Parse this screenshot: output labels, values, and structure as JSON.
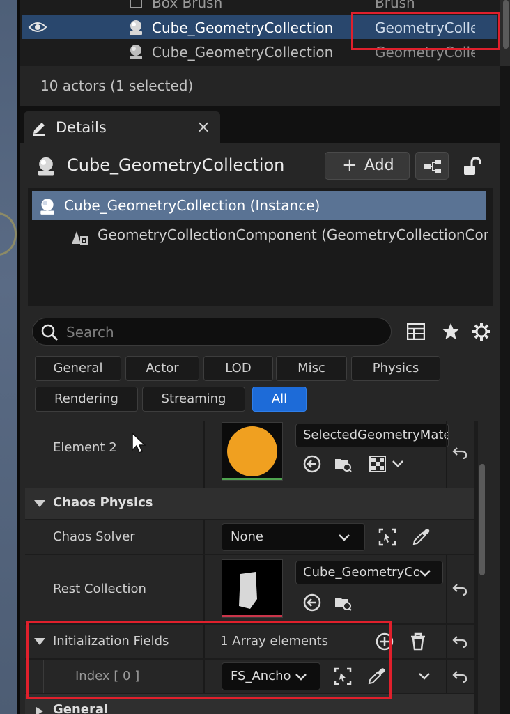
{
  "outliner": {
    "rows": [
      {
        "name": "Box Brush",
        "type": "Brush"
      },
      {
        "name": "Cube_GeometryCollection",
        "type": "GeometryCollectionActor",
        "selected": true
      },
      {
        "name": "Cube_GeometryCollection",
        "type": "GeometryCollectionActor"
      }
    ],
    "actor_count": "10 actors (1 selected)"
  },
  "details_tab": {
    "label": "Details",
    "close": "×"
  },
  "header": {
    "actor_name": "Cube_GeometryCollection",
    "add_label": "Add",
    "add_plus": "+"
  },
  "components": {
    "root": "Cube_GeometryCollection (Instance)",
    "child": "GeometryCollectionComponent (GeometryCollectionComponent)"
  },
  "search": {
    "placeholder": "Search"
  },
  "filters": [
    "General",
    "Actor",
    "LOD",
    "Misc",
    "Physics",
    "Rendering",
    "Streaming",
    "All"
  ],
  "active_filter": "All",
  "properties": {
    "element2": {
      "label": "Element 2",
      "material": "SelectedGeometryMaterial"
    },
    "chaos_category": "Chaos Physics",
    "chaos_solver": {
      "label": "Chaos Solver",
      "value": "None"
    },
    "rest_collection": {
      "label": "Rest Collection",
      "value": "Cube_GeometryCollection"
    },
    "init_fields": {
      "label": "Initialization Fields",
      "value": "1 Array elements"
    },
    "index": {
      "label": "Index [ 0 ]",
      "value": "FS_AnchorField"
    },
    "general_category": "General"
  },
  "colors": {
    "selection": "#29476d",
    "component_highlight": "#5a7394",
    "active_chip": "#1d6bd8",
    "annotation": "#e0202c",
    "material_orange": "#f0a020"
  }
}
